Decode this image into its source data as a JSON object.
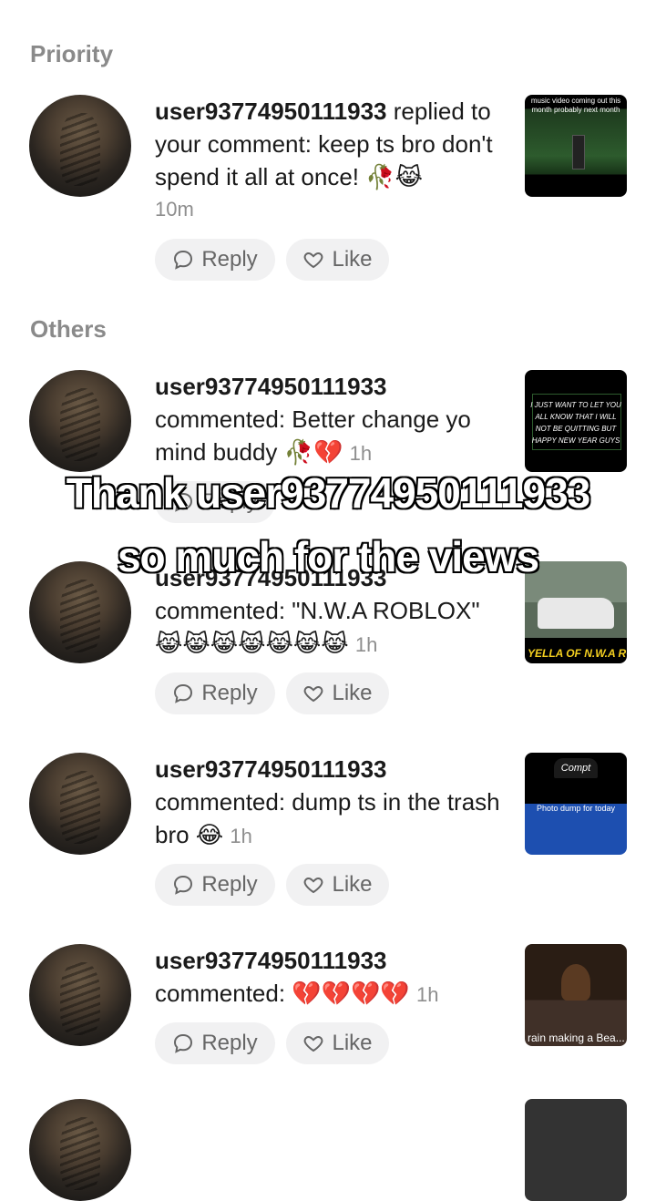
{
  "sections": {
    "priority": "Priority",
    "others": "Others"
  },
  "buttons": {
    "reply": "Reply",
    "like": "Like"
  },
  "notifications": [
    {
      "username": "user93774950111933",
      "message": "replied to your comment: keep ts bro don't spend it all at once! 🥀😹",
      "time": "10m",
      "thumb_caption": "music video coming out this month probably next month"
    },
    {
      "username": "user93774950111933",
      "message": "commented: Better change yo mind buddy 🥀💔",
      "time": "1h",
      "thumb_caption": "I JUST WANT TO LET YOU ALL KNOW THAT I WILL NOT BE QUITTING BUT HAPPY NEW YEAR GUYS"
    },
    {
      "username": "user93774950111933",
      "message": "commented: \"N.W.A ROBLOX\" 😹😹😹😹😹😹😹",
      "time": "1h",
      "thumb_caption": "YELLA OF N.W.A RO"
    },
    {
      "username": "user93774950111933",
      "message": "commented: dump ts in the trash bro 😂",
      "time": "1h",
      "thumb_caption": "Photo dump for today"
    },
    {
      "username": "user93774950111933",
      "message": "commented: 💔💔💔💔",
      "time": "1h",
      "thumb_caption": "rain making a Bea... izz my black AZZ"
    }
  ],
  "overlay_text": "Thank user93774950111933 so much for the views",
  "icons": [
    "reply-bubble-icon",
    "heart-icon"
  ]
}
